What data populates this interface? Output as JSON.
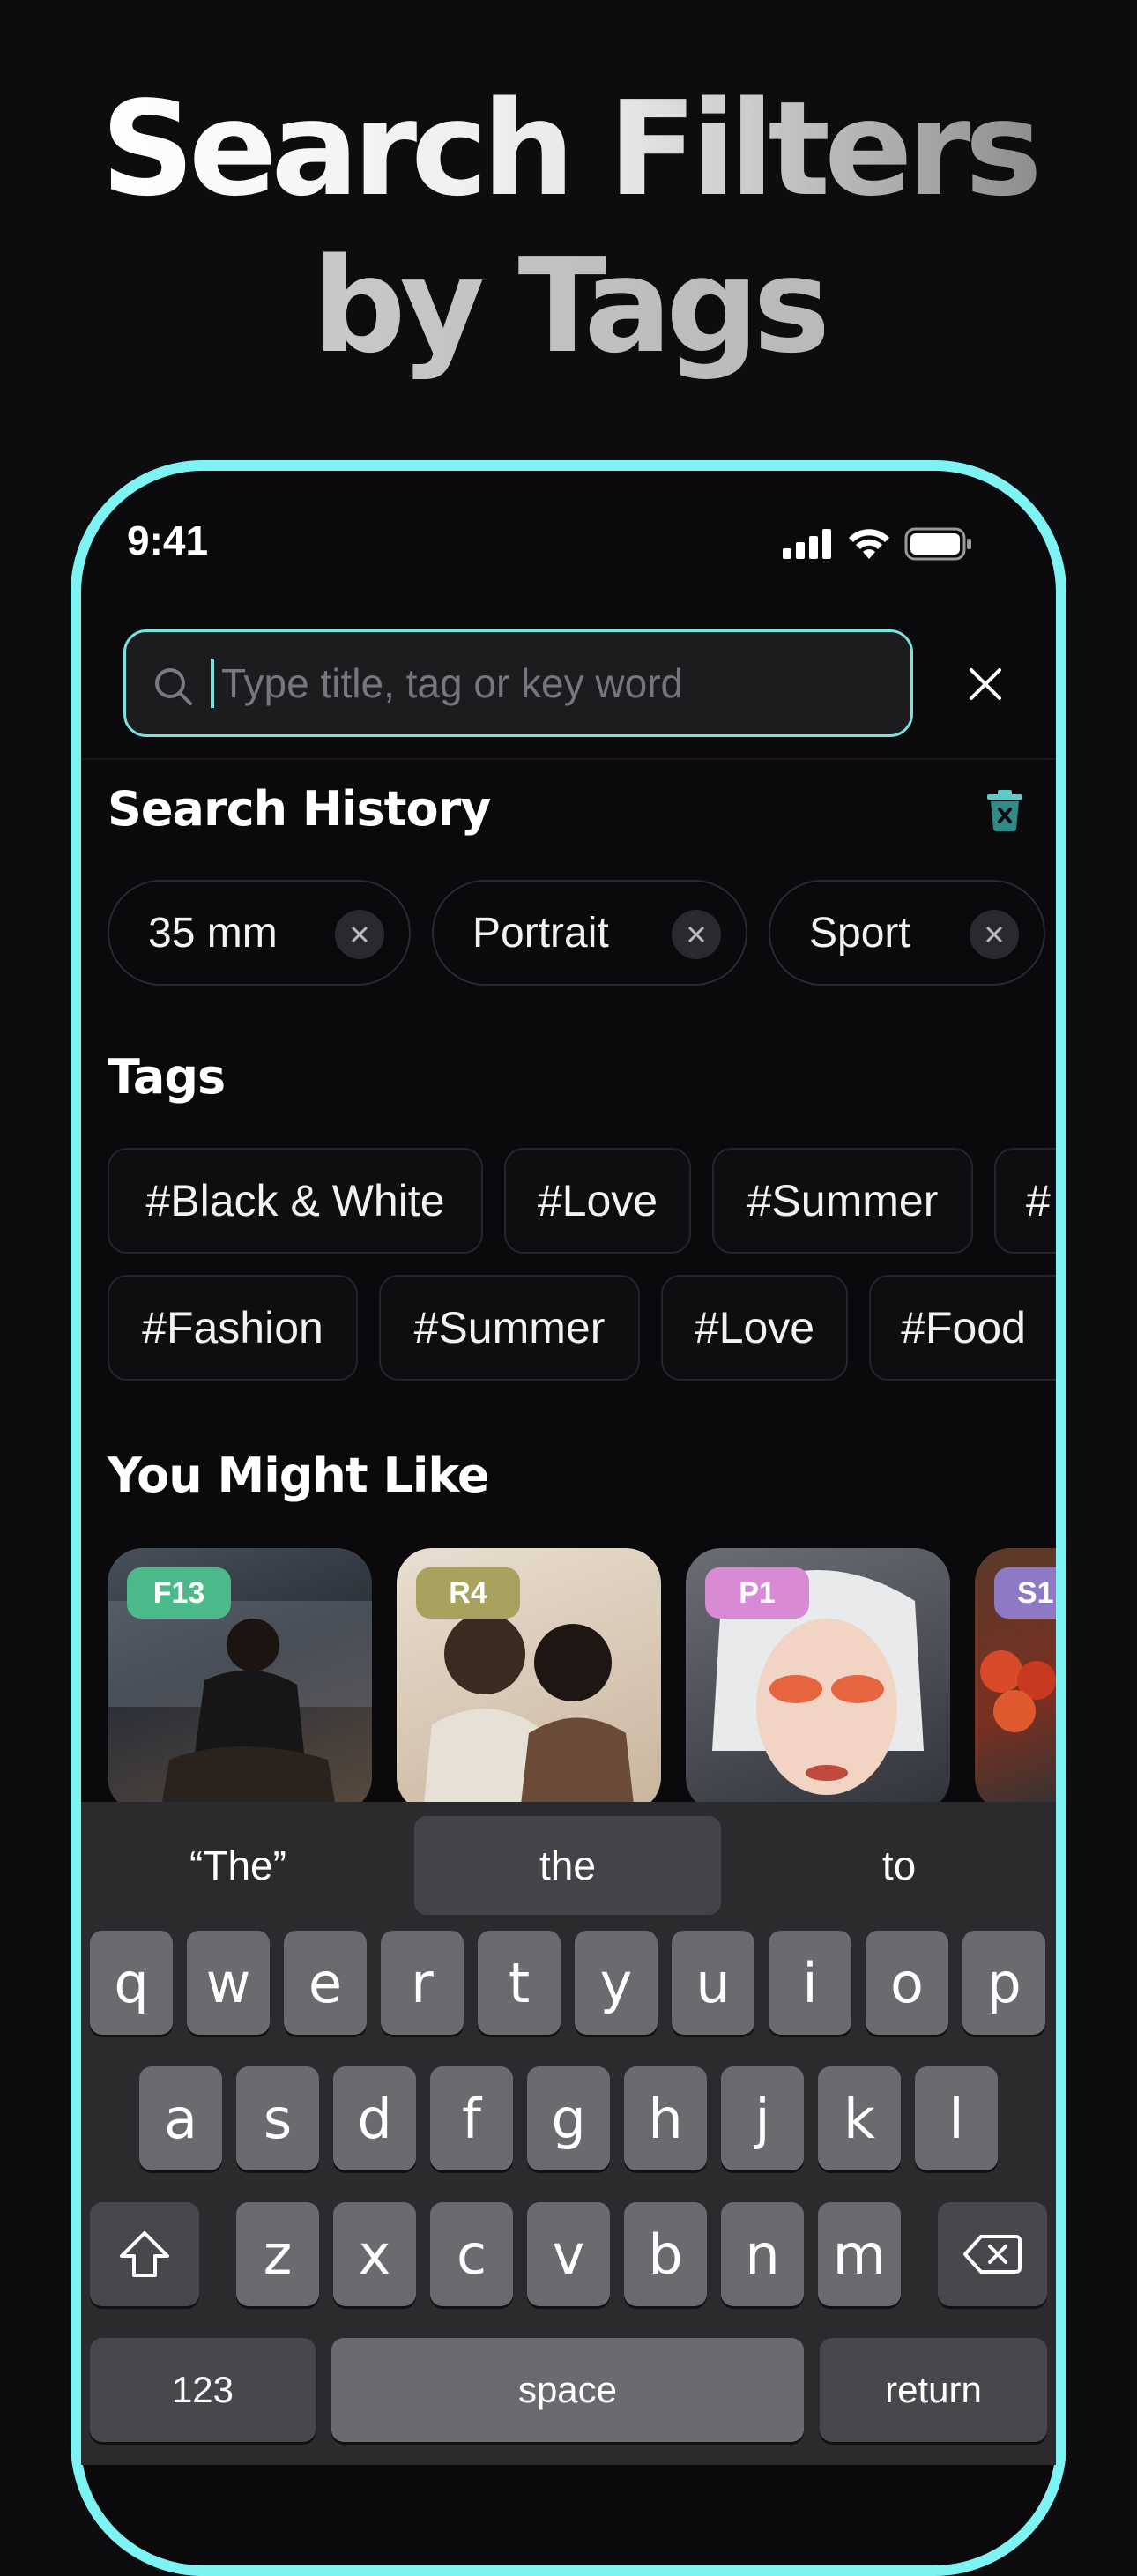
{
  "headline": {
    "line1": "Search Filters",
    "line2": "by Tags"
  },
  "status_bar": {
    "time": "9:41"
  },
  "search": {
    "placeholder": "Type title, tag or key word"
  },
  "search_history": {
    "title": "Search History",
    "items": [
      "35 mm",
      "Portrait",
      "Sport"
    ]
  },
  "tags": {
    "title": "Tags",
    "row1": [
      "#Black & White",
      "#Love",
      "#Summer",
      "#"
    ],
    "row2": [
      "#Fashion",
      "#Summer",
      "#Love",
      "#Food"
    ]
  },
  "you_might_like": {
    "title": "You Might Like",
    "cards": [
      {
        "badge": "F13",
        "badge_color": "#4cb98a"
      },
      {
        "badge": "R4",
        "badge_color": "#a7a35e"
      },
      {
        "badge": "P1",
        "badge_color": "#d98ad4"
      },
      {
        "badge": "S1",
        "badge_color": "#8e7ac4"
      }
    ]
  },
  "keyboard": {
    "suggestions": [
      "“The”",
      "the",
      "to"
    ],
    "row1": [
      "q",
      "w",
      "e",
      "r",
      "t",
      "y",
      "u",
      "i",
      "o",
      "p"
    ],
    "row2": [
      "a",
      "s",
      "d",
      "f",
      "g",
      "h",
      "j",
      "k",
      "l"
    ],
    "row3": [
      "z",
      "x",
      "c",
      "v",
      "b",
      "n",
      "m"
    ],
    "numbers_label": "123",
    "space_label": "space",
    "return_label": "return"
  },
  "colors": {
    "accent": "#7ef3f3",
    "background": "#0d0d0f"
  }
}
